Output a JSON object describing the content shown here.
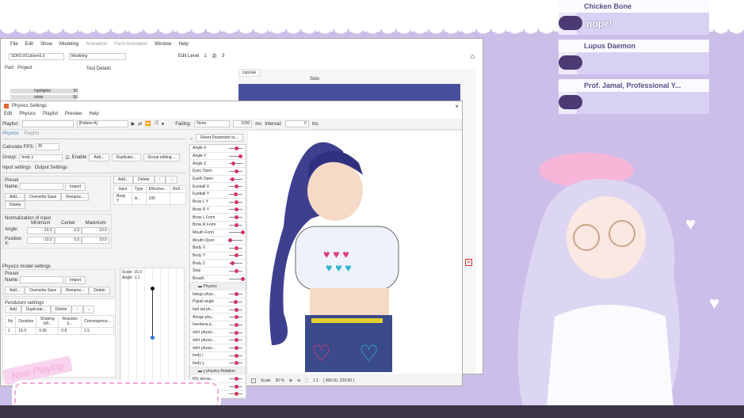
{
  "editor": {
    "menu": [
      "File",
      "Edit",
      "Show",
      "Modeling",
      "Animation",
      "Form Animation",
      "Window",
      "Help"
    ],
    "workspace": "SDK5.0/Cubism5.0",
    "mode": "Modeling",
    "edit_level_label": "Edit Level",
    "edit_levels": [
      "1",
      "2",
      "3"
    ],
    "tabs_left": [
      "Part",
      "Project"
    ],
    "tool_details": "Tool Details",
    "parts": [
      {
        "name": "highlights",
        "value": "50"
      },
      {
        "name": "white",
        "value": "50"
      }
    ],
    "doc_tab": "cassie",
    "solo": "Solo"
  },
  "physics": {
    "title": "Physics Settings",
    "menu": [
      "Edit",
      "Physics",
      "Playlist",
      "Preview",
      "Help"
    ],
    "playlist_label": "Playlist:",
    "pattern": "[Pattern A]",
    "fading_label": "Fading:",
    "fading": "None",
    "fade_ms": "1000",
    "ms": "ms",
    "interval_label": "Interval:",
    "interval": "0",
    "tabs": [
      "Physics",
      "Playlist"
    ],
    "fps_label": "Calculate FPS:",
    "fps": "30",
    "group_label": "Group:",
    "group": "body y",
    "enable": "Enable",
    "add": "Add...",
    "duplicate": "Duplicate...",
    "group_editing": "Group editing...",
    "subtabs": [
      "Input settings",
      "Output Settings"
    ],
    "preset": "Preset",
    "name_label": "Name:",
    "import": "Import",
    "overwrite": "Overwrite Save",
    "rename": "Rename...",
    "delete": "Delete",
    "input_table": {
      "headers": [
        "Input",
        "Type",
        "Effective...",
        "Refl..."
      ],
      "row": [
        "Body Y",
        "A...",
        "100",
        ""
      ]
    },
    "norm_title": "Normalization of input",
    "norm_headers": [
      "Minimum",
      "Center",
      "Maximum"
    ],
    "norm_rows": [
      {
        "label": "Angle:",
        "min": "-10.0",
        "center": "0.0",
        "max": "10.0"
      },
      {
        "label": "Position X:",
        "min": "-10.0",
        "center": "0.0",
        "max": "10.0"
      }
    ],
    "model_settings": "Physics model settings",
    "pendulum": "Pendulum settings",
    "add_short": "Add",
    "up": "↑",
    "down": "↓",
    "pend_headers": [
      "No",
      "Duration",
      "Shaking infl...",
      "Reaction (l...",
      "Convergence..."
    ],
    "pend_row": [
      "1",
      "15.0",
      "0.05",
      "0.8",
      "1.5"
    ],
    "scale_text": "Scale: 15.0",
    "angle_text": "Angle: 1.1",
    "reset": "Reset Parameter to...",
    "params": [
      {
        "label": "Angle X",
        "v": 0.55
      },
      {
        "label": "Angle Y",
        "v": 0.85
      },
      {
        "label": "Angle Z",
        "v": 0.3
      },
      {
        "label": "EyeL Open",
        "v": 0.5
      },
      {
        "label": "EyeR Open",
        "v": 0.25
      },
      {
        "label": "Eyeball X",
        "v": 0.5
      },
      {
        "label": "Eyeball Y",
        "v": 0.45
      },
      {
        "label": "Brow L Y",
        "v": 0.5
      },
      {
        "label": "Brow R Y",
        "v": 0.5
      },
      {
        "label": "Brow L Form",
        "v": 0.5
      },
      {
        "label": "Brow R Form",
        "v": 0.5
      },
      {
        "label": "Mouth Form",
        "v": 1.0
      },
      {
        "label": "Mouth Open",
        "v": 0.05
      },
      {
        "label": "Body X",
        "v": 0.5
      },
      {
        "label": "Body Y",
        "v": 0.5
      },
      {
        "label": "Body Z",
        "v": 0.25
      },
      {
        "label": "Step",
        "v": 0.5
      },
      {
        "label": "Breath",
        "v": 1.0
      }
    ],
    "group_physics": "Physics",
    "phys_params": [
      {
        "label": "bangs phys...",
        "v": 0.5
      },
      {
        "label": "Pigtail angle",
        "v": 0.45
      },
      {
        "label": "belt tail ph...",
        "v": 0.5
      },
      {
        "label": "Ahoge phy...",
        "v": 0.5
      },
      {
        "label": "bandana p...",
        "v": 0.5
      },
      {
        "label": "shirt physic...",
        "v": 0.5
      },
      {
        "label": "shirt physic...",
        "v": 0.55
      },
      {
        "label": "shirt physic...",
        "v": 0.5
      },
      {
        "label": "body r",
        "v": 0.5
      },
      {
        "label": "body y",
        "v": 0.5
      }
    ],
    "group_rotation": "y physics Rotation",
    "rot_params": [
      {
        "label": "[0]y physic...",
        "v": 0.5
      },
      {
        "label": "[1]y physic...",
        "v": 0.5
      },
      {
        "label": "[2]y physic...",
        "v": 0.5
      }
    ],
    "status": {
      "scale_label": "Scale",
      "zoom": "30 %",
      "ratio": "1:1",
      "coords": "[ 366.00, 229.00 ]"
    }
  },
  "chat": [
    {
      "name": "Chicken Bone",
      "message": "nope!"
    },
    {
      "name": "Lupus Daemon",
      "message": ""
    },
    {
      "name": "Prof. Jamal, Professional Y...",
      "message": ""
    }
  ],
  "now_playing": "Now Playing",
  "colors": {
    "bg": "#cbbfe9",
    "accent": "#d8345f",
    "chat_name": "#5c4f86"
  }
}
